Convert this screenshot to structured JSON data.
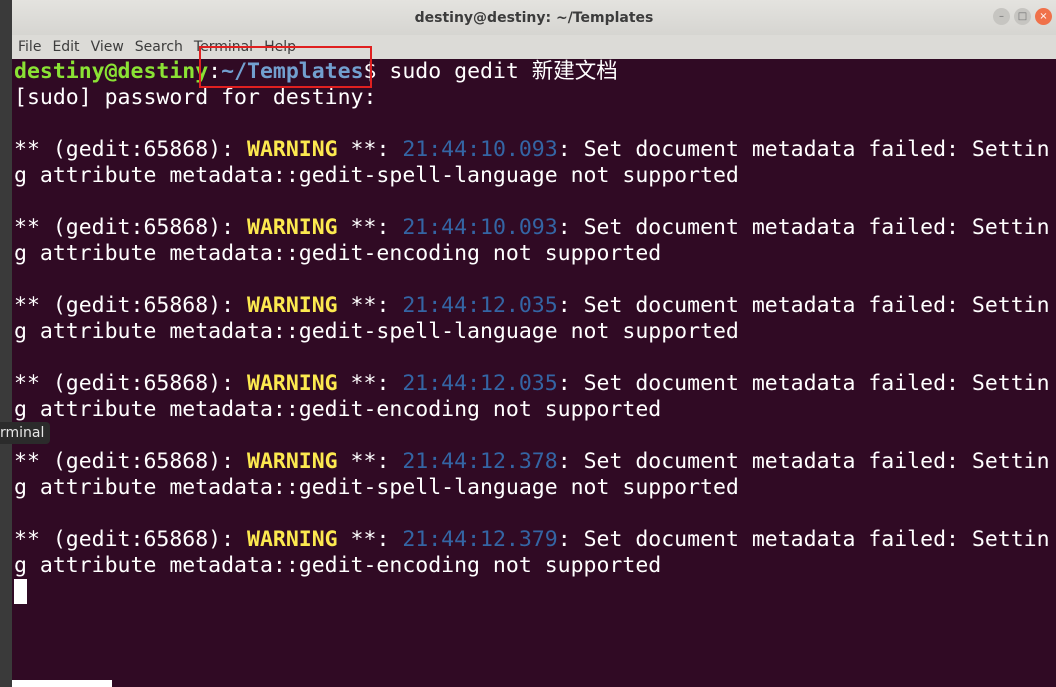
{
  "window": {
    "title": "destiny@destiny: ~/Templates",
    "menu": [
      "File",
      "Edit",
      "View",
      "Search",
      "Terminal",
      "Help"
    ]
  },
  "prompt": {
    "user_host": "destiny@destiny",
    "sep": ":",
    "path": "~/Templates",
    "dollar": "$",
    "command": " sudo gedit 新建文档"
  },
  "sudo_line": "[sudo] password for destiny:",
  "warnings": [
    {
      "prefix": "** (gedit:65868): ",
      "level": "WARNING",
      "mid": " **: ",
      "time": "21:44:10.093",
      "msg": ": Set document metadata failed: Settin",
      "cont": "g attribute metadata::gedit-spell-language not supported"
    },
    {
      "prefix": "** (gedit:65868): ",
      "level": "WARNING",
      "mid": " **: ",
      "time": "21:44:10.093",
      "msg": ": Set document metadata failed: Settin",
      "cont": "g attribute metadata::gedit-encoding not supported"
    },
    {
      "prefix": "** (gedit:65868): ",
      "level": "WARNING",
      "mid": " **: ",
      "time": "21:44:12.035",
      "msg": ": Set document metadata failed: Settin",
      "cont": "g attribute metadata::gedit-spell-language not supported"
    },
    {
      "prefix": "** (gedit:65868): ",
      "level": "WARNING",
      "mid": " **: ",
      "time": "21:44:12.035",
      "msg": ": Set document metadata failed: Settin",
      "cont": "g attribute metadata::gedit-encoding not supported"
    },
    {
      "prefix": "** (gedit:65868): ",
      "level": "WARNING",
      "mid": " **: ",
      "time": "21:44:12.378",
      "msg": ": Set document metadata failed: Settin",
      "cont": "g attribute metadata::gedit-spell-language not supported"
    },
    {
      "prefix": "** (gedit:65868): ",
      "level": "WARNING",
      "mid": " **: ",
      "time": "21:44:12.379",
      "msg": ": Set document metadata failed: Settin",
      "cont": "g attribute metadata::gedit-encoding not supported"
    }
  ],
  "tooltip": "rminal",
  "colors": {
    "background": "#300a24",
    "user": "#8ae234",
    "path": "#729fcf",
    "warning": "#fce94f",
    "timestamp": "#3465a4",
    "highlight": "#e02020"
  }
}
